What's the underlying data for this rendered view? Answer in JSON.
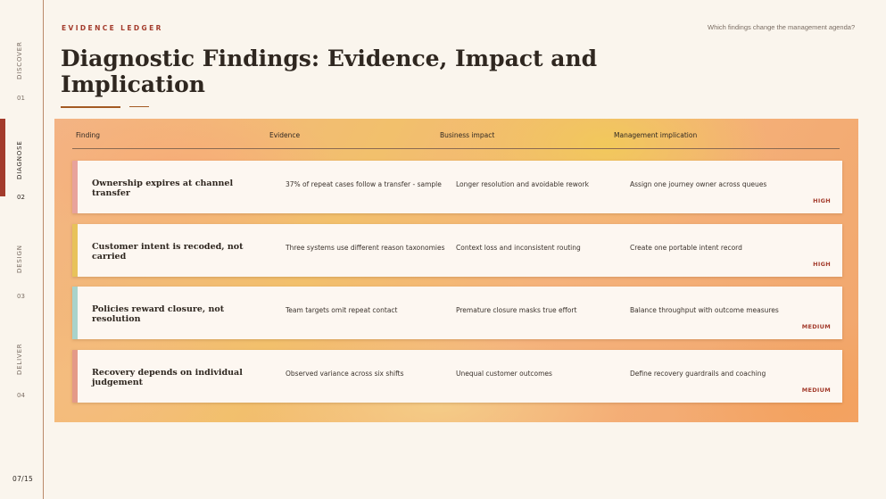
{
  "rail": {
    "sections": [
      {
        "label": "DISCOVER",
        "num": "01"
      },
      {
        "label": "DIAGNOSE",
        "num": "02"
      },
      {
        "label": "DESIGN",
        "num": "03"
      },
      {
        "label": "DELIVER",
        "num": "04"
      }
    ],
    "active_index": 1,
    "active_color": "#a33b2c",
    "page": "07/15"
  },
  "header": {
    "eyebrow": "EVIDENCE LEDGER",
    "question": "Which findings change the management agenda?",
    "title": "Diagnostic Findings: Evidence, Impact and Implication"
  },
  "table": {
    "columns": [
      "Finding",
      "Evidence",
      "Business impact",
      "Management implication"
    ],
    "rows": [
      {
        "finding": "Ownership expires at channel transfer",
        "evidence": "37% of repeat cases follow a transfer - sample",
        "impact": "Longer resolution and avoidable rework",
        "implication": "Assign one journey owner across queues",
        "priority": "HIGH",
        "accent": "#e8a39c"
      },
      {
        "finding": "Customer intent is recoded, not carried",
        "evidence": "Three systems use different reason taxonomies",
        "impact": "Context loss and inconsistent routing",
        "implication": "Create one portable intent record",
        "priority": "HIGH",
        "accent": "#e8c25a"
      },
      {
        "finding": "Policies reward closure, not resolution",
        "evidence": "Team targets omit repeat contact",
        "impact": "Premature closure masks true effort",
        "implication": "Balance throughput with outcome measures",
        "priority": "MEDIUM",
        "accent": "#a9d3cb"
      },
      {
        "finding": "Recovery depends on individual judgement",
        "evidence": "Observed variance across six shifts",
        "impact": "Unequal customer outcomes",
        "implication": "Define recovery guardrails and coaching",
        "priority": "MEDIUM",
        "accent": "#e49a88"
      }
    ]
  }
}
